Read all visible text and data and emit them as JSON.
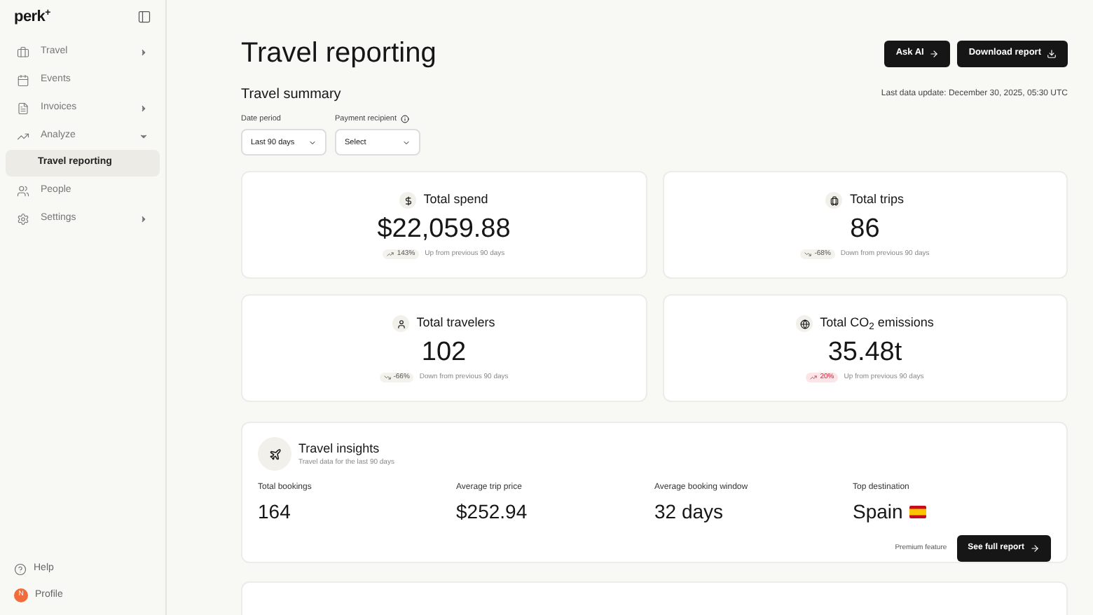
{
  "sidebar": {
    "logo": "perk",
    "logo_mark": "+",
    "items": [
      {
        "label": "Travel",
        "selected": false,
        "expanded": false
      },
      {
        "label": "Events",
        "selected": false
      },
      {
        "label": "Invoices",
        "selected": false,
        "expanded": false
      },
      {
        "label": "Analyze",
        "selected": false,
        "expanded": true,
        "children": [
          {
            "label": "Travel reporting",
            "selected": true
          }
        ]
      },
      {
        "label": "People",
        "selected": false
      },
      {
        "label": "Settings",
        "selected": false,
        "expanded": false
      }
    ],
    "footer": [
      {
        "label": "Help",
        "kind": "help"
      },
      {
        "label": "Profile",
        "kind": "avatar",
        "avatar": "N"
      }
    ]
  },
  "header": {
    "title": "Travel reporting",
    "buttons": [
      "Ask AI",
      "Download report"
    ]
  },
  "summary": {
    "title": "Travel summary",
    "last_update": "Last data update: December 30, 2025, 05:30 UTC",
    "filters": [
      {
        "label": "Date period",
        "value": "Last 90 days"
      },
      {
        "label": "Payment recipient",
        "value": "Select"
      }
    ]
  },
  "metrics": [
    {
      "title": "Total spend",
      "value": "$22,059.88",
      "change": "143%",
      "kind": "up",
      "note": "Up from previous 90 days"
    },
    {
      "title": "Total trips",
      "value": "86",
      "change": "-68%",
      "kind": "down",
      "note": "Down from previous 90 days"
    },
    {
      "title": "Total travelers",
      "value": "102",
      "change": "-66%",
      "kind": "down",
      "note": "Down from previous 90 days"
    },
    {
      "title": "Total CO$_{2}$ emissions",
      "value": "35.48t",
      "change": "20%",
      "kind": "warning",
      "note": "Up from previous 90 days"
    }
  ],
  "insights": {
    "title": "Travel insights",
    "subtitle": "Travel data for the last 90 days",
    "stats": [
      {
        "label": "Total bookings",
        "value": "164"
      },
      {
        "label": "Average trip price",
        "value": "$252.94"
      },
      {
        "label": "Average booking window",
        "value": "32 days"
      },
      {
        "label": "Top destination",
        "value": "Spain"
      }
    ],
    "premium_note": "Premium feature",
    "button": "See full report"
  }
}
